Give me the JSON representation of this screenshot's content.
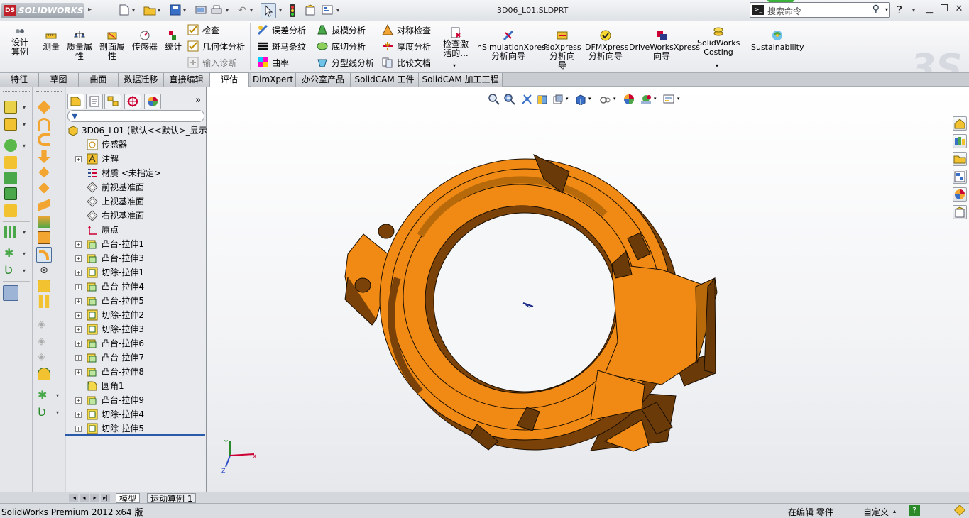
{
  "app": {
    "brand": "SOLIDWORKS",
    "doc_title": "3D06_L01.SLDPRT",
    "search_placeholder": "搜索命令",
    "help_label": "?",
    "colors": {
      "part_orange": "#f08a14",
      "part_shadow": "#6a3a08",
      "accent_red": "#c0202a"
    }
  },
  "quick_toolbar": [
    "new-icon",
    "open-icon",
    "save-icon",
    "print-icon",
    "undo-icon",
    "select-icon",
    "rebuild-icon",
    "file-properties-icon",
    "options-icon"
  ],
  "ribbon": {
    "large_buttons": [
      {
        "label": "设计算例"
      },
      {
        "label": "测量"
      },
      {
        "label": "质量属性"
      },
      {
        "label": "剖面属性"
      },
      {
        "label": "传感器"
      },
      {
        "label": "统计"
      }
    ],
    "col1": [
      {
        "label": "检查"
      },
      {
        "label": "几何体分析"
      },
      {
        "label": "输入诊断"
      }
    ],
    "col2": [
      {
        "label": "误差分析"
      },
      {
        "label": "斑马条纹"
      },
      {
        "label": "曲率"
      }
    ],
    "col3": [
      {
        "label": "拔模分析"
      },
      {
        "label": "底切分析"
      },
      {
        "label": "分型线分析"
      }
    ],
    "col4": [
      {
        "label": "对称检查"
      },
      {
        "label": "厚度分析"
      },
      {
        "label": "比较文档"
      }
    ],
    "check_active": {
      "label": "检查激活的..."
    },
    "xpress": [
      {
        "line1": "nSimulationXpress",
        "line2": "分析向导"
      },
      {
        "line1": "FloXpress",
        "line2": "分析向导"
      },
      {
        "line1": "DFMXpress",
        "line2": "分析向导"
      },
      {
        "line1": "DriveWorksXpress",
        "line2": "向导"
      },
      {
        "line1": "SolidWorks",
        "line2": "Costing"
      },
      {
        "line1": "Sustainability",
        "line2": ""
      }
    ]
  },
  "tabs": [
    {
      "label": "特征"
    },
    {
      "label": "草图"
    },
    {
      "label": "曲面"
    },
    {
      "label": "数据迁移"
    },
    {
      "label": "直接编辑"
    },
    {
      "label": "评估"
    },
    {
      "label": "DimXpert"
    },
    {
      "label": "办公室产品"
    },
    {
      "label": "SolidCAM 工件"
    },
    {
      "label": "SolidCAM 加工工程"
    }
  ],
  "tree": {
    "root": "3D06_L01 (默认<<默认>_显示",
    "items": [
      {
        "label": "传感器",
        "icon": "sensor-icon",
        "expand": false
      },
      {
        "label": "注解",
        "icon": "annotation-icon",
        "expand": true
      },
      {
        "label": "材质 <未指定>",
        "icon": "material-icon",
        "expand": false
      },
      {
        "label": "前视基准面",
        "icon": "plane-icon",
        "expand": false
      },
      {
        "label": "上视基准面",
        "icon": "plane-icon",
        "expand": false
      },
      {
        "label": "右视基准面",
        "icon": "plane-icon",
        "expand": false
      },
      {
        "label": "原点",
        "icon": "origin-icon",
        "expand": false
      },
      {
        "label": "凸台-拉伸1",
        "icon": "boss-extrude-icon",
        "expand": true
      },
      {
        "label": "凸台-拉伸3",
        "icon": "boss-extrude-icon",
        "expand": true
      },
      {
        "label": "切除-拉伸1",
        "icon": "cut-extrude-icon",
        "expand": true
      },
      {
        "label": "凸台-拉伸4",
        "icon": "boss-extrude-icon",
        "expand": true
      },
      {
        "label": "凸台-拉伸5",
        "icon": "boss-extrude-icon",
        "expand": true
      },
      {
        "label": "切除-拉伸2",
        "icon": "cut-extrude-icon",
        "expand": true
      },
      {
        "label": "切除-拉伸3",
        "icon": "cut-extrude-icon",
        "expand": true
      },
      {
        "label": "凸台-拉伸6",
        "icon": "boss-extrude-icon",
        "expand": true
      },
      {
        "label": "凸台-拉伸7",
        "icon": "boss-extrude-icon",
        "expand": true
      },
      {
        "label": "凸台-拉伸8",
        "icon": "boss-extrude-icon",
        "expand": true
      },
      {
        "label": "圆角1",
        "icon": "fillet-icon",
        "expand": false
      },
      {
        "label": "凸台-拉伸9",
        "icon": "boss-extrude-icon",
        "expand": true
      },
      {
        "label": "切除-拉伸4",
        "icon": "cut-extrude-icon",
        "expand": true
      },
      {
        "label": "切除-拉伸5",
        "icon": "cut-extrude-icon",
        "expand": true
      }
    ]
  },
  "bottom_tabs": [
    {
      "label": "模型"
    },
    {
      "label": "运动算例 1"
    }
  ],
  "status": {
    "product": "SolidWorks Premium 2012 x64 版",
    "mode": "在编辑 零件",
    "units": "自定义"
  },
  "triad": {
    "x": "X",
    "y": "Y",
    "z": "Z"
  }
}
